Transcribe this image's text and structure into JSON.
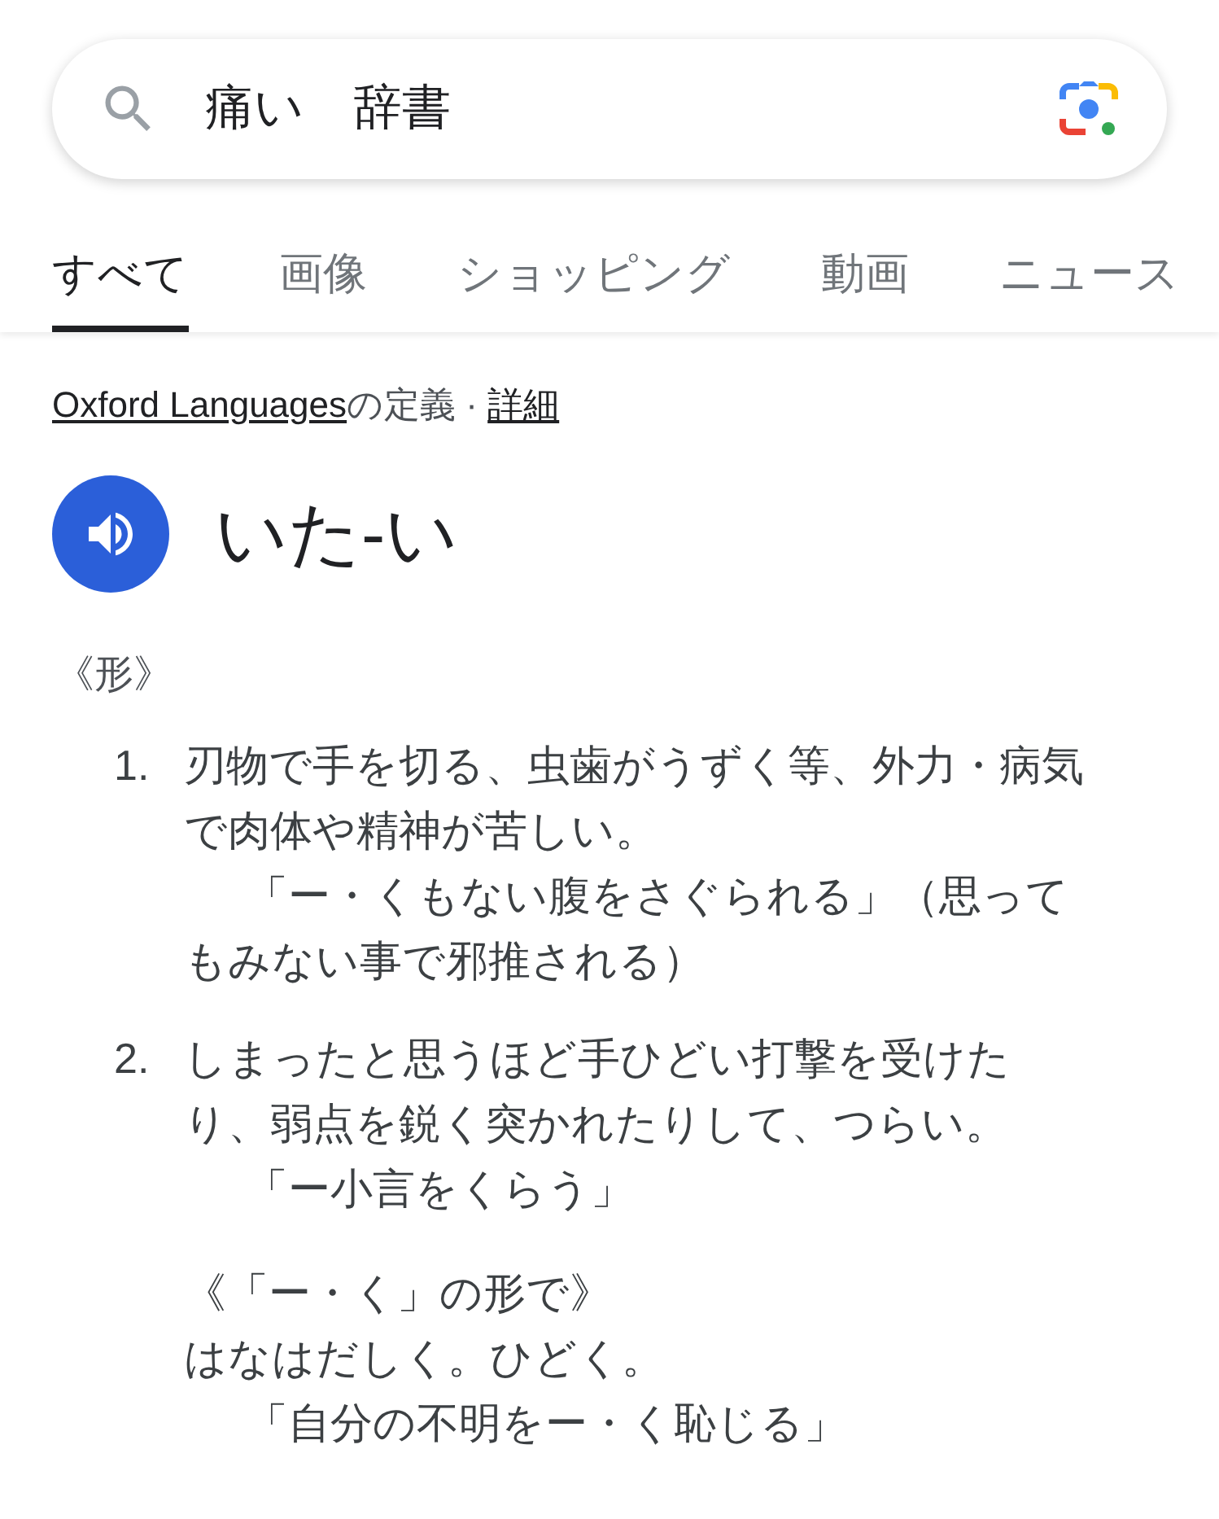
{
  "search": {
    "value": "痛い　辞書"
  },
  "tabs": [
    {
      "label": "すべて",
      "selected": true
    },
    {
      "label": "画像",
      "selected": false
    },
    {
      "label": "ショッピング",
      "selected": false
    },
    {
      "label": "動画",
      "selected": false
    },
    {
      "label": "ニュース",
      "selected": false
    }
  ],
  "source": {
    "link": "Oxford Languages",
    "text": "の定義 · ",
    "details_link": "詳細"
  },
  "headword": "いた-い",
  "part_of_speech": "《形》",
  "senses": [
    {
      "number": "1.",
      "definition": "刃物で手を切る、虫歯がうずく等、外力・病気で肉体や精神が苦しい。",
      "examples": [
        "「ー・くもない腹をさぐられる」（思ってもみない事で邪推される）"
      ]
    },
    {
      "number": "2.",
      "definition": "しまったと思うほど手ひどい打撃を受けたり、弱点を鋭く突かれたりして、つらい。",
      "examples": [
        "「ー小言をくらう」"
      ]
    }
  ],
  "usage": {
    "label": "《「ー・く」の形で》",
    "definition": "はなはだしく。ひどく。",
    "examples": [
      "「自分の不明をー・く恥じる」"
    ]
  }
}
